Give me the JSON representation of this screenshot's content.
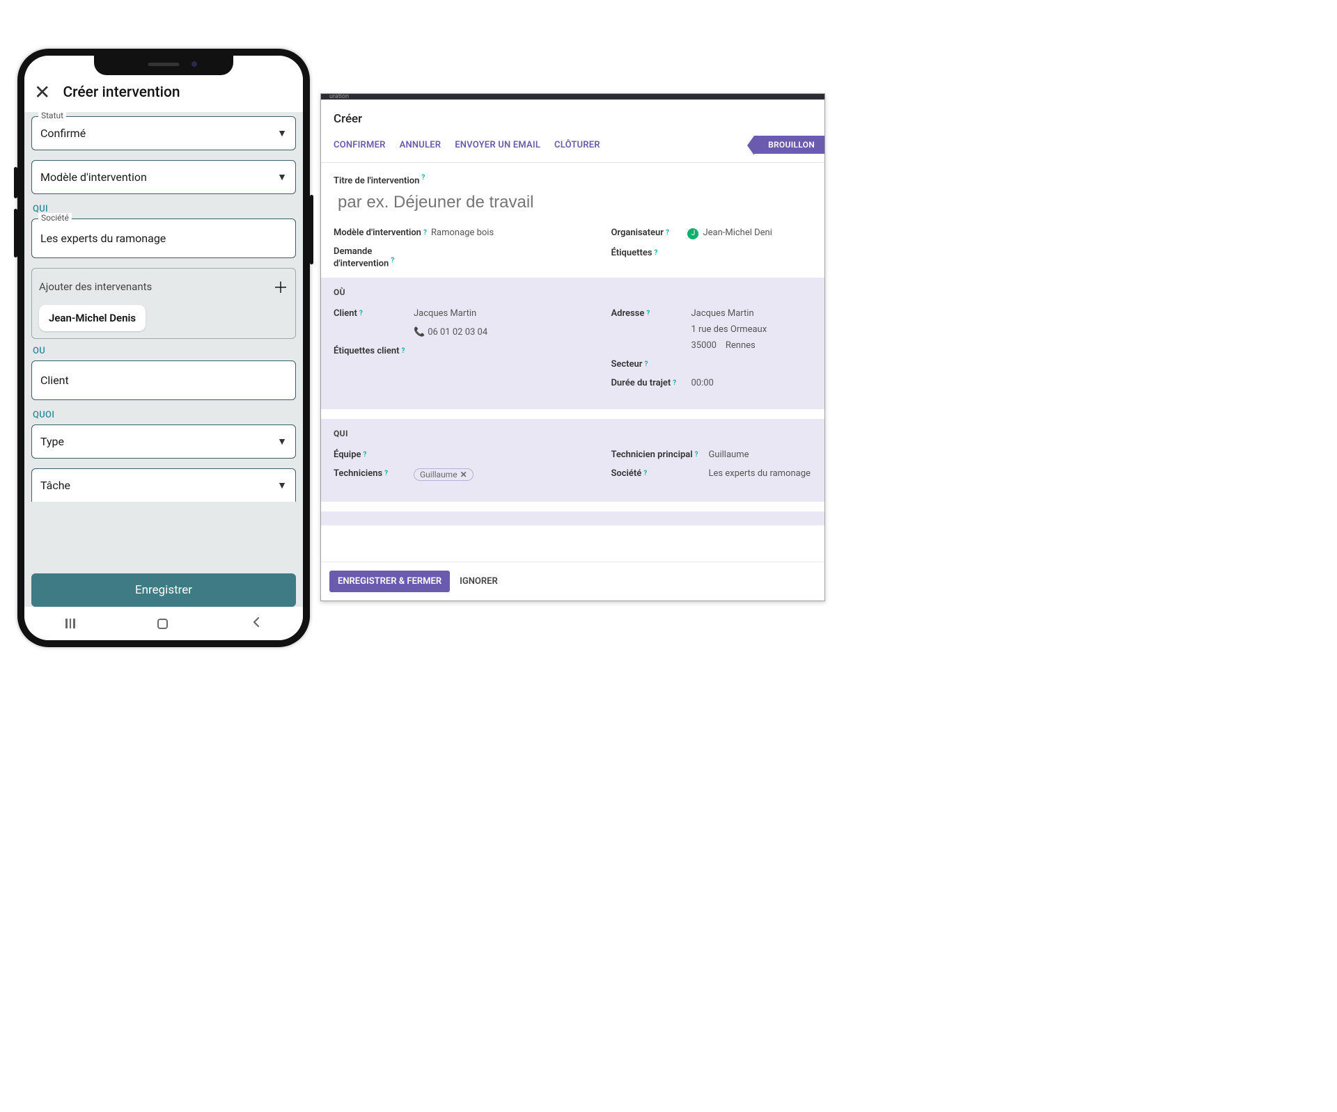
{
  "mobile": {
    "title": "Créer intervention",
    "status": {
      "label": "Statut",
      "value": "Confirmé"
    },
    "model": {
      "label": "Modèle d'intervention"
    },
    "sections": {
      "who": "QUI",
      "where": "OU",
      "what": "QUOI"
    },
    "company": {
      "label": "Société",
      "value": "Les experts du ramonage"
    },
    "add_workers": {
      "label": "Ajouter des intervenants",
      "chips": [
        "Jean-Michel Denis"
      ]
    },
    "client_label": "Client",
    "type_label": "Type",
    "task_label": "Tâche",
    "save_button": "Enregistrer"
  },
  "web": {
    "top_strip": "uration",
    "title": "Créer",
    "actions": [
      "CONFIRMER",
      "ANNULER",
      "ENVOYER UN EMAIL",
      "CLÔTURER"
    ],
    "status_flag": "BROUILLON",
    "intervention_title": {
      "label": "Titre de l'intervention",
      "placeholder": "par ex. Déjeuner de travail"
    },
    "model": {
      "label": "Modèle d'intervention",
      "value": "Ramonage bois"
    },
    "request": {
      "label_line1": "Demande",
      "label_line2": "d'intervention"
    },
    "organizer": {
      "label": "Organisateur",
      "avatar": "J",
      "value": "Jean-Michel Deni"
    },
    "tags": {
      "label": "Étiquettes"
    },
    "where": {
      "head": "OÙ",
      "client": {
        "label": "Client",
        "name": "Jacques Martin",
        "phone": "06 01 02 03 04"
      },
      "client_tags_label": "Étiquettes client",
      "address": {
        "label": "Adresse",
        "name": "Jacques Martin",
        "street": "1 rue des Ormeaux",
        "zip": "35000",
        "city": "Rennes"
      },
      "sector": {
        "label": "Secteur"
      },
      "travel": {
        "label": "Durée du trajet",
        "value": "00:00"
      }
    },
    "who": {
      "head": "QUI",
      "team": {
        "label": "Équipe"
      },
      "technicians": {
        "label": "Techniciens",
        "chip": "Guillaume"
      },
      "main_tech": {
        "label": "Technicien principal",
        "value": "Guillaume"
      },
      "company": {
        "label": "Société",
        "value": "Les experts du ramonage"
      }
    },
    "footer": {
      "save": "ENREGISTRER & FERMER",
      "ignore": "IGNORER"
    }
  }
}
